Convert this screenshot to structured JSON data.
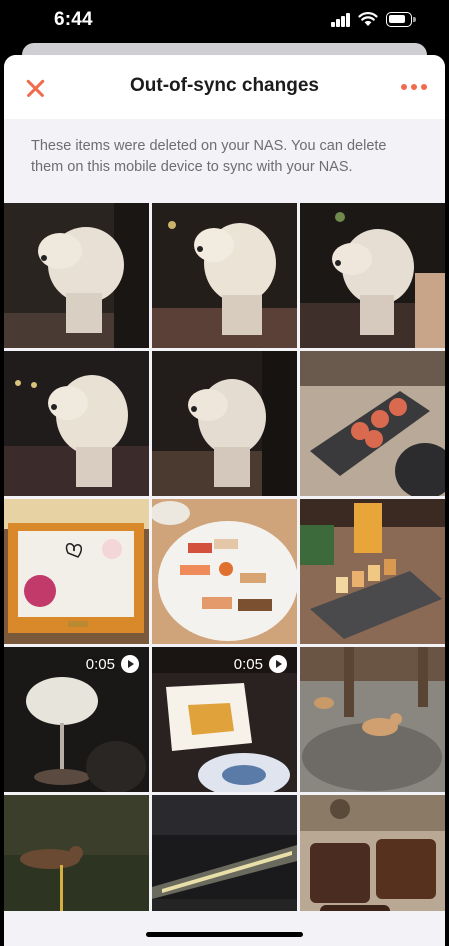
{
  "status_bar": {
    "time": "6:44",
    "signal_icon": "cellular-signal-icon",
    "wifi_icon": "wifi-icon",
    "battery_icon": "battery-icon"
  },
  "header": {
    "title": "Out-of-sync changes",
    "close_icon": "close-icon",
    "more_icon": "more-dots-icon",
    "accent_color": "#f06a4c"
  },
  "description": "These items were deleted on your NAS. You can delete them on this mobile device to sync with your NAS.",
  "photos": [
    {
      "subject": "dog-photo",
      "duration": ""
    },
    {
      "subject": "dog-photo",
      "duration": ""
    },
    {
      "subject": "dog-photo",
      "duration": ""
    },
    {
      "subject": "dog-photo",
      "duration": ""
    },
    {
      "subject": "dog-photo",
      "duration": ""
    },
    {
      "subject": "sushi-platter-photo",
      "duration": ""
    },
    {
      "subject": "gift-box-photo",
      "duration": ""
    },
    {
      "subject": "sushi-plate-photo",
      "duration": ""
    },
    {
      "subject": "dessert-board-photo",
      "duration": ""
    },
    {
      "subject": "lamp-video",
      "duration": "0:05"
    },
    {
      "subject": "food-video",
      "duration": "0:05"
    },
    {
      "subject": "shiba-dogs-photo",
      "duration": ""
    },
    {
      "subject": "dog-walk-photo",
      "duration": ""
    },
    {
      "subject": "river-night-photo",
      "duration": ""
    },
    {
      "subject": "bread-photo",
      "duration": ""
    }
  ]
}
